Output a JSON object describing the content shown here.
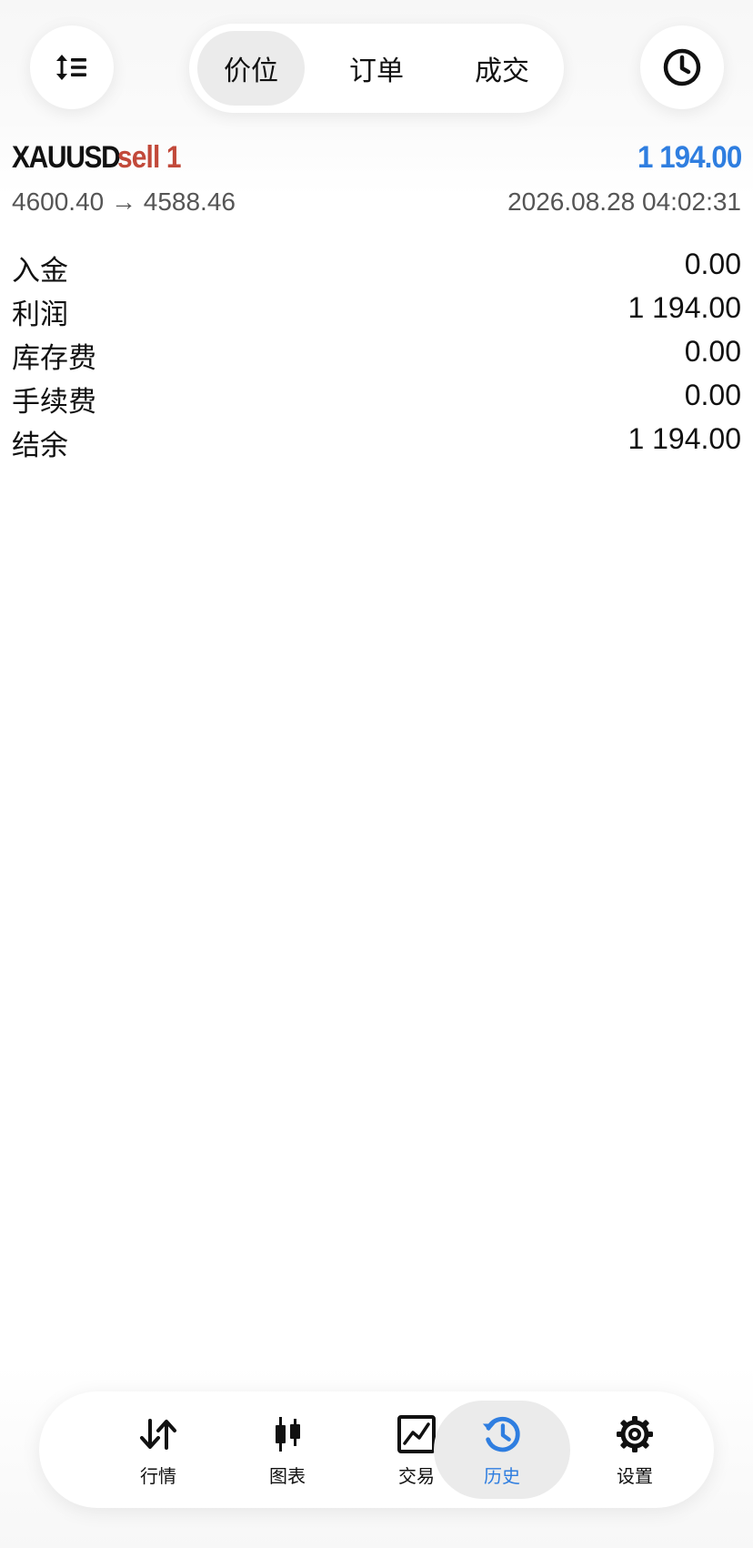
{
  "header": {
    "tabs": [
      {
        "label": "价位",
        "active": true
      },
      {
        "label": "订单",
        "active": false
      },
      {
        "label": "成交",
        "active": false
      }
    ],
    "sort_icon": "sort-arrows-icon",
    "history_icon": "clock-icon"
  },
  "deal": {
    "symbol": "XAUUSD",
    "side": "sell 1",
    "profit": "1 194.00",
    "price_range": "4600.40 → 4588.46",
    "time": "2026.08.28 04:02:31"
  },
  "summary": [
    {
      "label": "入金",
      "value": "0.00"
    },
    {
      "label": "利润",
      "value": "1 194.00"
    },
    {
      "label": "库存费",
      "value": "0.00"
    },
    {
      "label": "手续费",
      "value": "0.00"
    },
    {
      "label": "结余",
      "value": "1 194.00"
    }
  ],
  "nav": [
    {
      "label": "行情",
      "icon": "quotes-arrows-icon",
      "active": false
    },
    {
      "label": "图表",
      "icon": "candlestick-chart-icon",
      "active": false
    },
    {
      "label": "交易",
      "icon": "trade-chart-icon",
      "active": false
    },
    {
      "label": "历史",
      "icon": "history-icon",
      "active": true
    },
    {
      "label": "设置",
      "icon": "gear-icon",
      "active": false
    }
  ],
  "colors": {
    "accent": "#2f7ee0",
    "sell": "#c2493a",
    "active_bg": "#ebebeb"
  }
}
